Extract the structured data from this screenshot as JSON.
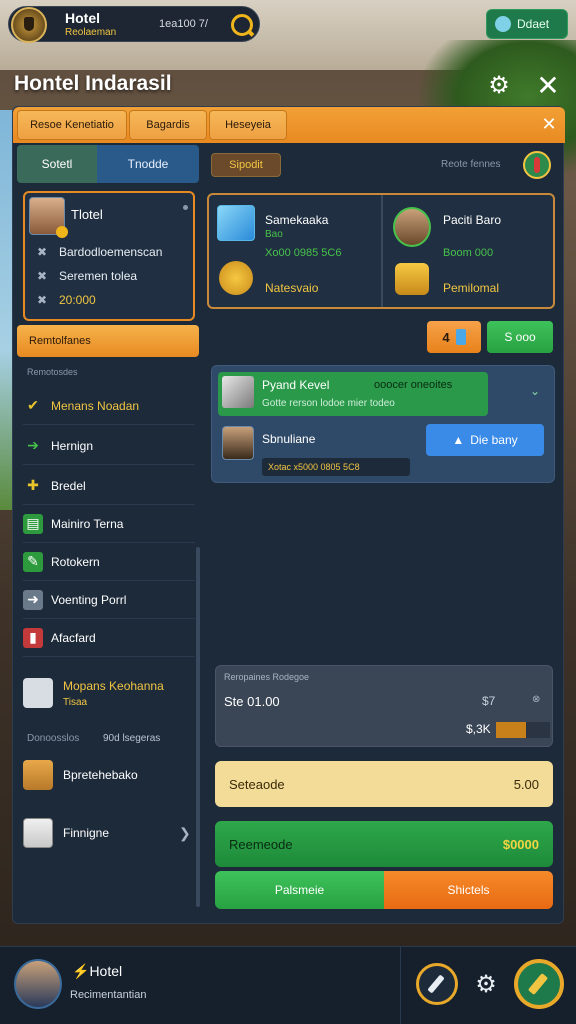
{
  "topbar": {
    "title": "Hotel",
    "subtitle": "Reolaeman",
    "stat": "1ea100 7/",
    "right_button": "Ddaet"
  },
  "window": {
    "title": "Hontel Indarasil"
  },
  "tabs": [
    "Resoe Kenetiatio",
    "Bagardis",
    "Heseyeia"
  ],
  "left": {
    "segments": [
      "Sotetl",
      "Tnodde"
    ],
    "hotel_card": {
      "name": "Tlotel",
      "lines": [
        "Bardodloemenscan",
        "Seremen tolea",
        "20:000"
      ]
    },
    "orange_bar": "Remtolfanes",
    "section_label": "Remotosdes",
    "items": [
      {
        "label": "Menans Noadan",
        "icon": "check-icon"
      },
      {
        "label": "Hernign",
        "icon": "arrow-icon"
      },
      {
        "label": "Bredel",
        "icon": "wrench-icon"
      },
      {
        "label": "Mainiro Terna",
        "icon": "document-icon"
      },
      {
        "label": "Rotokern",
        "icon": "edit-icon"
      },
      {
        "label": "Voenting Porrl",
        "icon": "tag-icon"
      },
      {
        "label": "Afacfard",
        "icon": "book-icon"
      }
    ],
    "featured": {
      "label": "Mopans Keohanna",
      "sub": "Tisaa"
    },
    "divider_left": "Donoosslos",
    "divider_right": "90d lsegeras",
    "bottom_items": [
      "Bpretehebako",
      "Finnigne"
    ]
  },
  "right": {
    "pill": "Sipodit",
    "header_label": "Reote fennes",
    "card_left": {
      "title": "Samekaaka",
      "sub": "Bao",
      "value": "Xo00 0985 5C6",
      "gold": "Natesvaio"
    },
    "card_right": {
      "title": "Paciti Baro",
      "value": "Boom 000",
      "gold": "Pemilomal"
    },
    "btn_count": "4",
    "btn_green": "S ooo",
    "list_green_title": "Pyand Kevel",
    "list_green_right": "ooocer oneoites",
    "list_green_sub": "Gotte rerson lodoe mier todeo",
    "person_name": "Sbnuliane",
    "blue_button": "Die bany",
    "chip_text": "Xotac x5000 0805 5C8",
    "info": {
      "label": "Reropaines Rodegoe",
      "value": "Ste 01.00",
      "right_value": "$7",
      "bar_value": "$,3K",
      "progress": 0.55
    },
    "bar_cream": {
      "label": "Seteaode",
      "value": "5.00"
    },
    "bar_green": {
      "label": "Reemeode",
      "value": "$0000"
    },
    "split_left": "Palsmeie",
    "split_right": "Shictels"
  },
  "bottom": {
    "title_prefix": "Hotel",
    "subtitle": "Recimentantian"
  }
}
